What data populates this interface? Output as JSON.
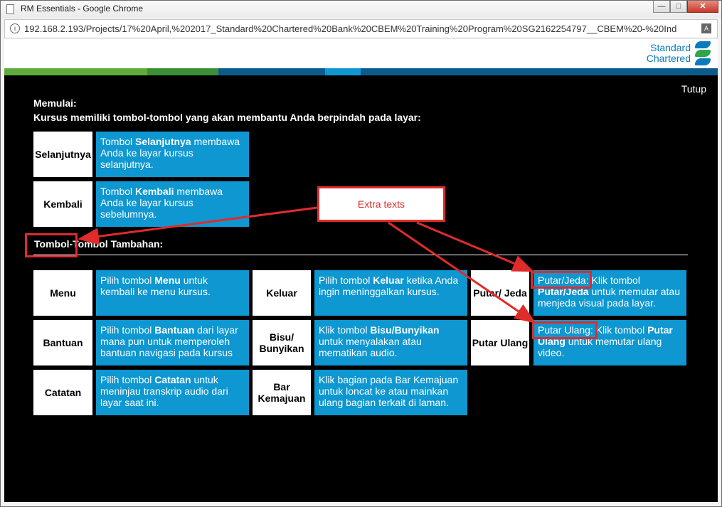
{
  "window": {
    "title": "RM Essentials - Google Chrome",
    "url": "192.168.2.193/Projects/17%20April,%202017_Standard%20Chartered%20Bank%20CBEM%20Training%20Program%20SG2162254797__CBEM%20-%20Ind"
  },
  "logo": {
    "line1": "Standard",
    "line2": "Chartered"
  },
  "stripe_colors": [
    "#5fac3d",
    "#3d8f35",
    "#0b5c8c",
    "#0e97d0",
    "#0b5c8c"
  ],
  "close_label": "Tutup",
  "intro": {
    "line1": "Memulai:",
    "line2": "Kursus memiliki tombol-tombol yang akan membantu Anda berpindah pada layar:"
  },
  "primary": [
    {
      "label": "Selanjutnya",
      "pre": "Tombol ",
      "bold": "Selanjutnya",
      "post": " membawa Anda ke layar kursus selanjutnya."
    },
    {
      "label": "Kembali",
      "pre": "Tombol ",
      "bold": "Kembali",
      "post": " membawa Anda ke layar kursus sebelumnya."
    }
  ],
  "additional_title": "Tombol-Tombol Tambahan:",
  "additional": [
    {
      "label": "Menu",
      "pre": "Pilih tombol ",
      "bold": "Menu",
      "post": " untuk kembali ke menu kursus."
    },
    {
      "label": "Bantuan",
      "pre": "Pilih tombol ",
      "bold": "Bantuan",
      "post": " dari layar mana pun untuk memperoleh bantuan navigasi pada kursus"
    },
    {
      "label": "Catatan",
      "pre": "Pilih tombol ",
      "bold": "Catatan",
      "post": " untuk meninjau transkrip audio dari layar saat ini."
    },
    {
      "label": "Keluar",
      "pre": "Pilih tombol ",
      "bold": "Keluar",
      "post": " ketika Anda ingin meninggalkan kursus."
    },
    {
      "label": "Bisu/ Bunyikan",
      "pre": "Klik tombol ",
      "bold": "Bisu/Bunyikan",
      "post": " untuk menyalakan atau mematikan audio."
    },
    {
      "label": "Bar Kemajuan",
      "pre": "",
      "bold": "",
      "post": "Klik bagian pada Bar Kemajuan untuk loncat ke atau mainkan ulang bagian terkait di laman."
    },
    {
      "label": "Putar/ Jeda",
      "pre": "Putar/Jeda: Klik tombol ",
      "bold": "Putar/Jeda",
      "post": " untuk memutar atau menjeda visual pada layar."
    },
    {
      "label": "Putar Ulang",
      "pre": "Putar Ulang: Klik tombol ",
      "bold": "Putar Ulang",
      "post": " untuk memutar ulang video."
    }
  ],
  "annotation": {
    "text": "Extra texts",
    "color": "#e02b2b"
  }
}
